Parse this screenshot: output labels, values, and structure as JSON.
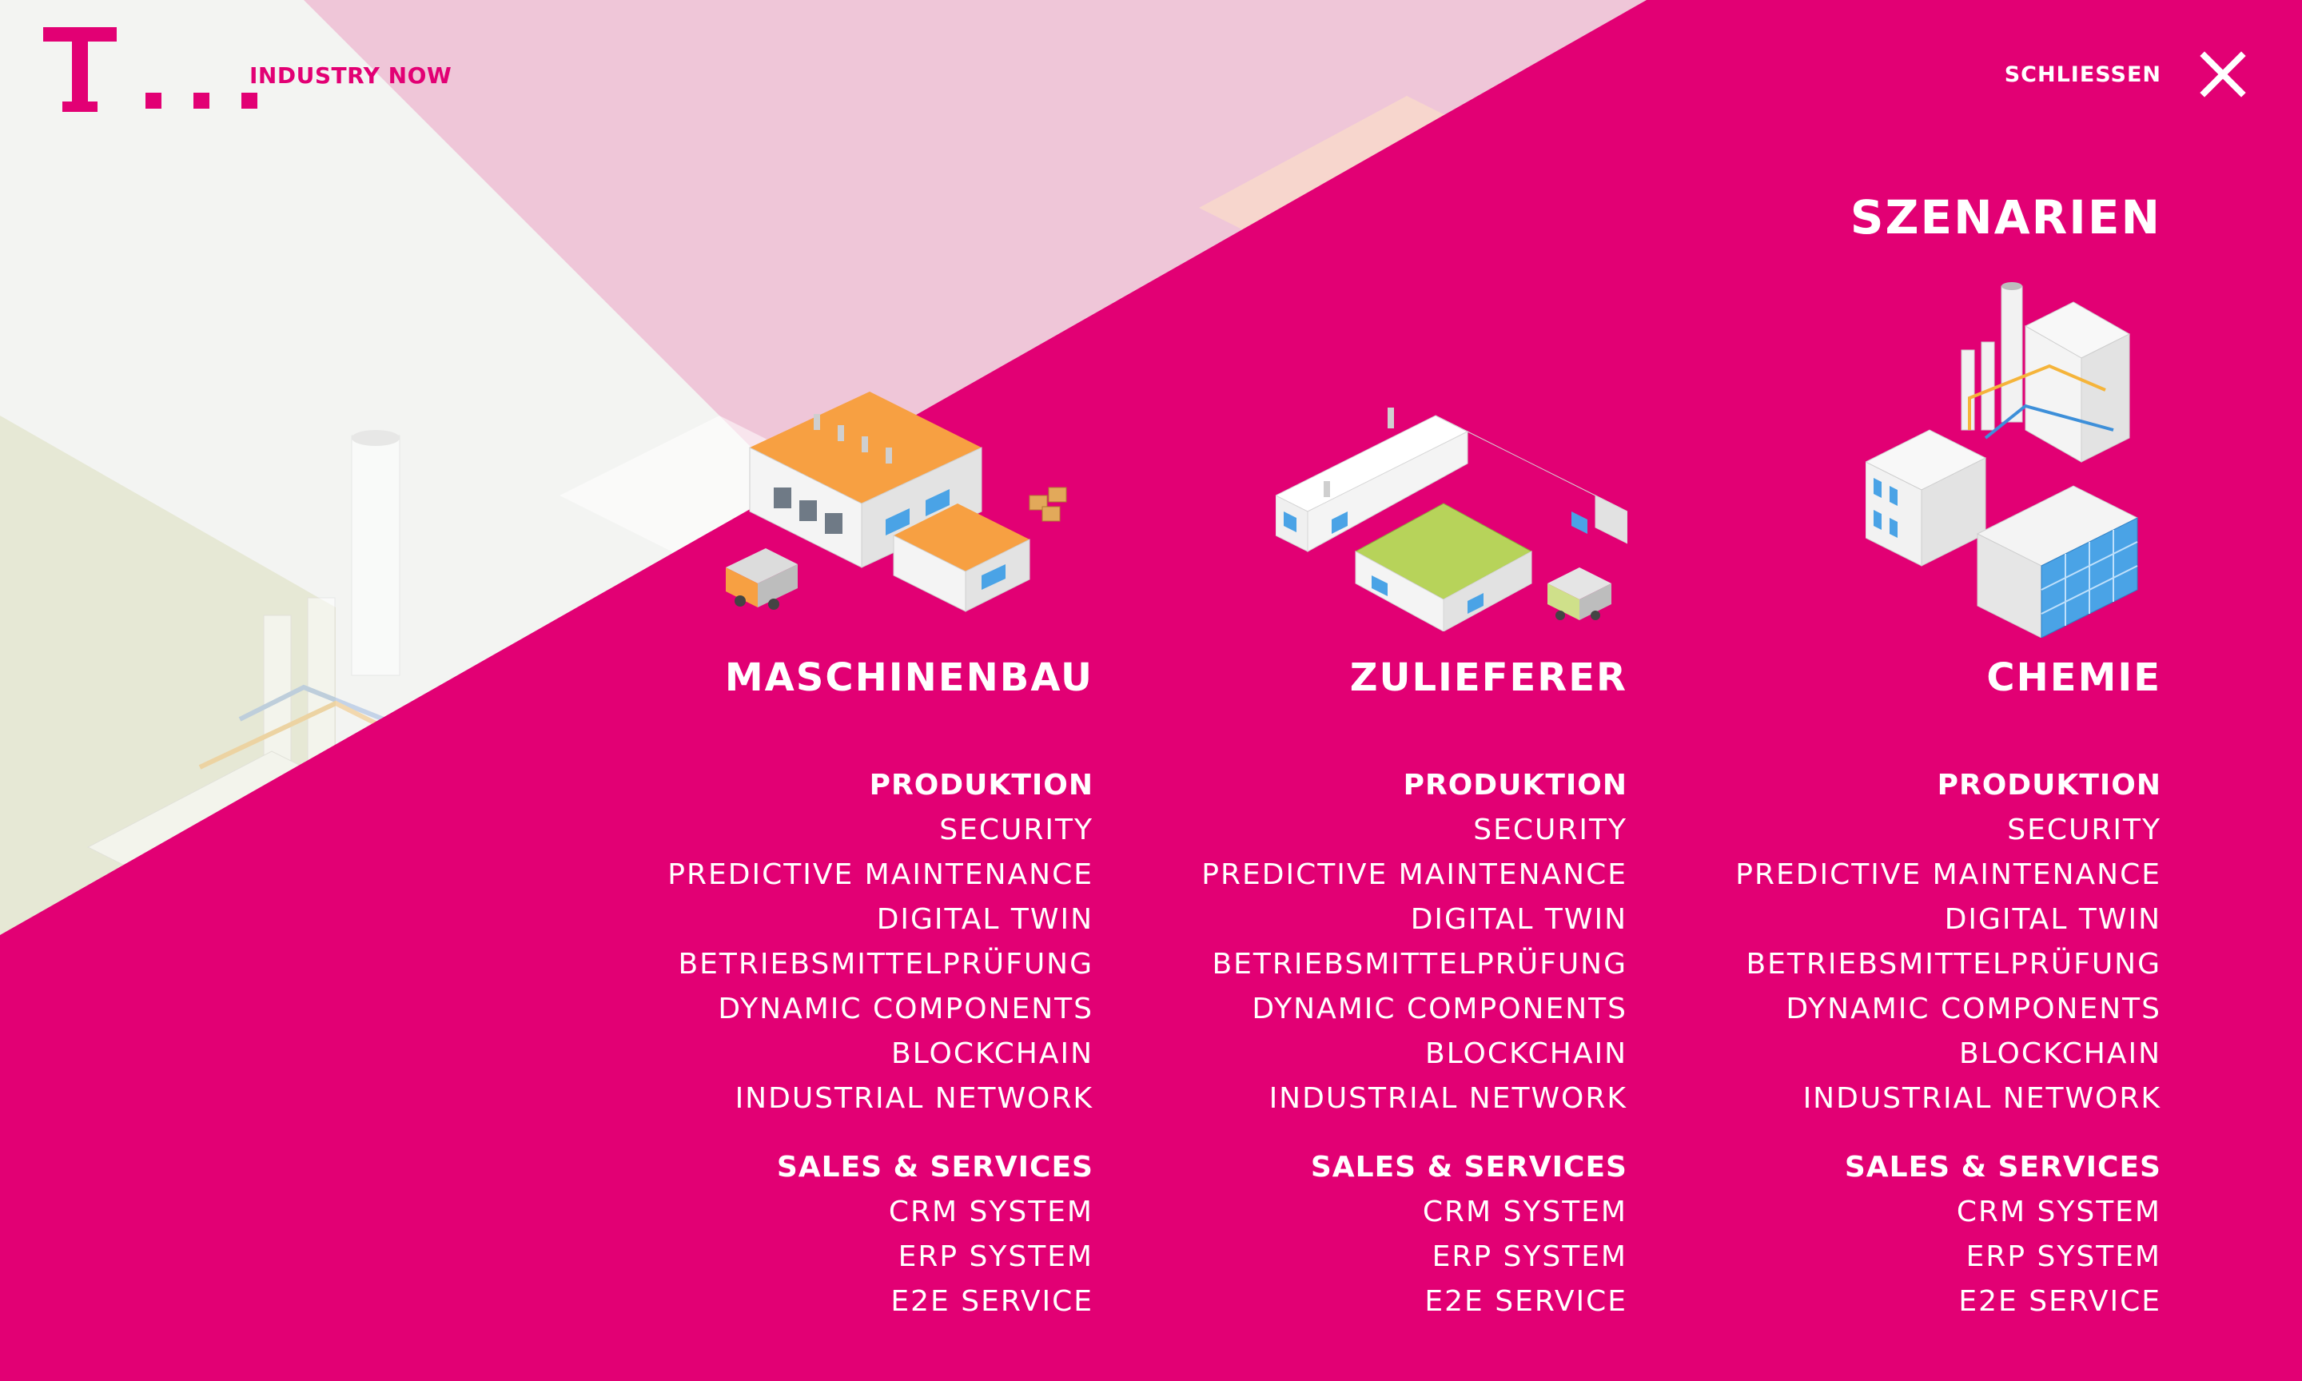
{
  "header": {
    "brand_name": "INDUSTRY NOW",
    "close_label": "SCHLIESSEN"
  },
  "overlay": {
    "title": "SZENARIEN",
    "columns": [
      {
        "title": "MASCHINENBAU",
        "illustration": "factory-orange-illustration",
        "sections": [
          {
            "heading": "PRODUKTION",
            "items": [
              "SECURITY",
              "PREDICTIVE MAINTENANCE",
              "DIGITAL TWIN",
              "BETRIEBSMITTELPRÜFUNG",
              "DYNAMIC COMPONENTS",
              "BLOCKCHAIN",
              "INDUSTRIAL NETWORK"
            ]
          },
          {
            "heading": "SALES & SERVICES",
            "items": [
              "CRM SYSTEM",
              "ERP SYSTEM",
              "E2E SERVICE"
            ]
          }
        ]
      },
      {
        "title": "ZULIEFERER",
        "illustration": "factory-green-illustration",
        "sections": [
          {
            "heading": "PRODUKTION",
            "items": [
              "SECURITY",
              "PREDICTIVE MAINTENANCE",
              "DIGITAL TWIN",
              "BETRIEBSMITTELPRÜFUNG",
              "DYNAMIC COMPONENTS",
              "BLOCKCHAIN",
              "INDUSTRIAL NETWORK"
            ]
          },
          {
            "heading": "SALES & SERVICES",
            "items": [
              "CRM SYSTEM",
              "ERP SYSTEM",
              "E2E SERVICE"
            ]
          }
        ]
      },
      {
        "title": "CHEMIE",
        "illustration": "chemical-plant-illustration",
        "sections": [
          {
            "heading": "PRODUKTION",
            "items": [
              "SECURITY",
              "PREDICTIVE MAINTENANCE",
              "DIGITAL TWIN",
              "BETRIEBSMITTELPRÜFUNG",
              "DYNAMIC COMPONENTS",
              "BLOCKCHAIN",
              "INDUSTRIAL NETWORK"
            ]
          },
          {
            "heading": "SALES & SERVICES",
            "items": [
              "CRM SYSTEM",
              "ERP SYSTEM",
              "E2E SERVICE"
            ]
          }
        ]
      }
    ]
  },
  "colors": {
    "brand_magenta": "#e20074",
    "text_on_overlay": "#ffffff"
  },
  "icons": [
    "telekom-logo-icon",
    "close-icon"
  ]
}
